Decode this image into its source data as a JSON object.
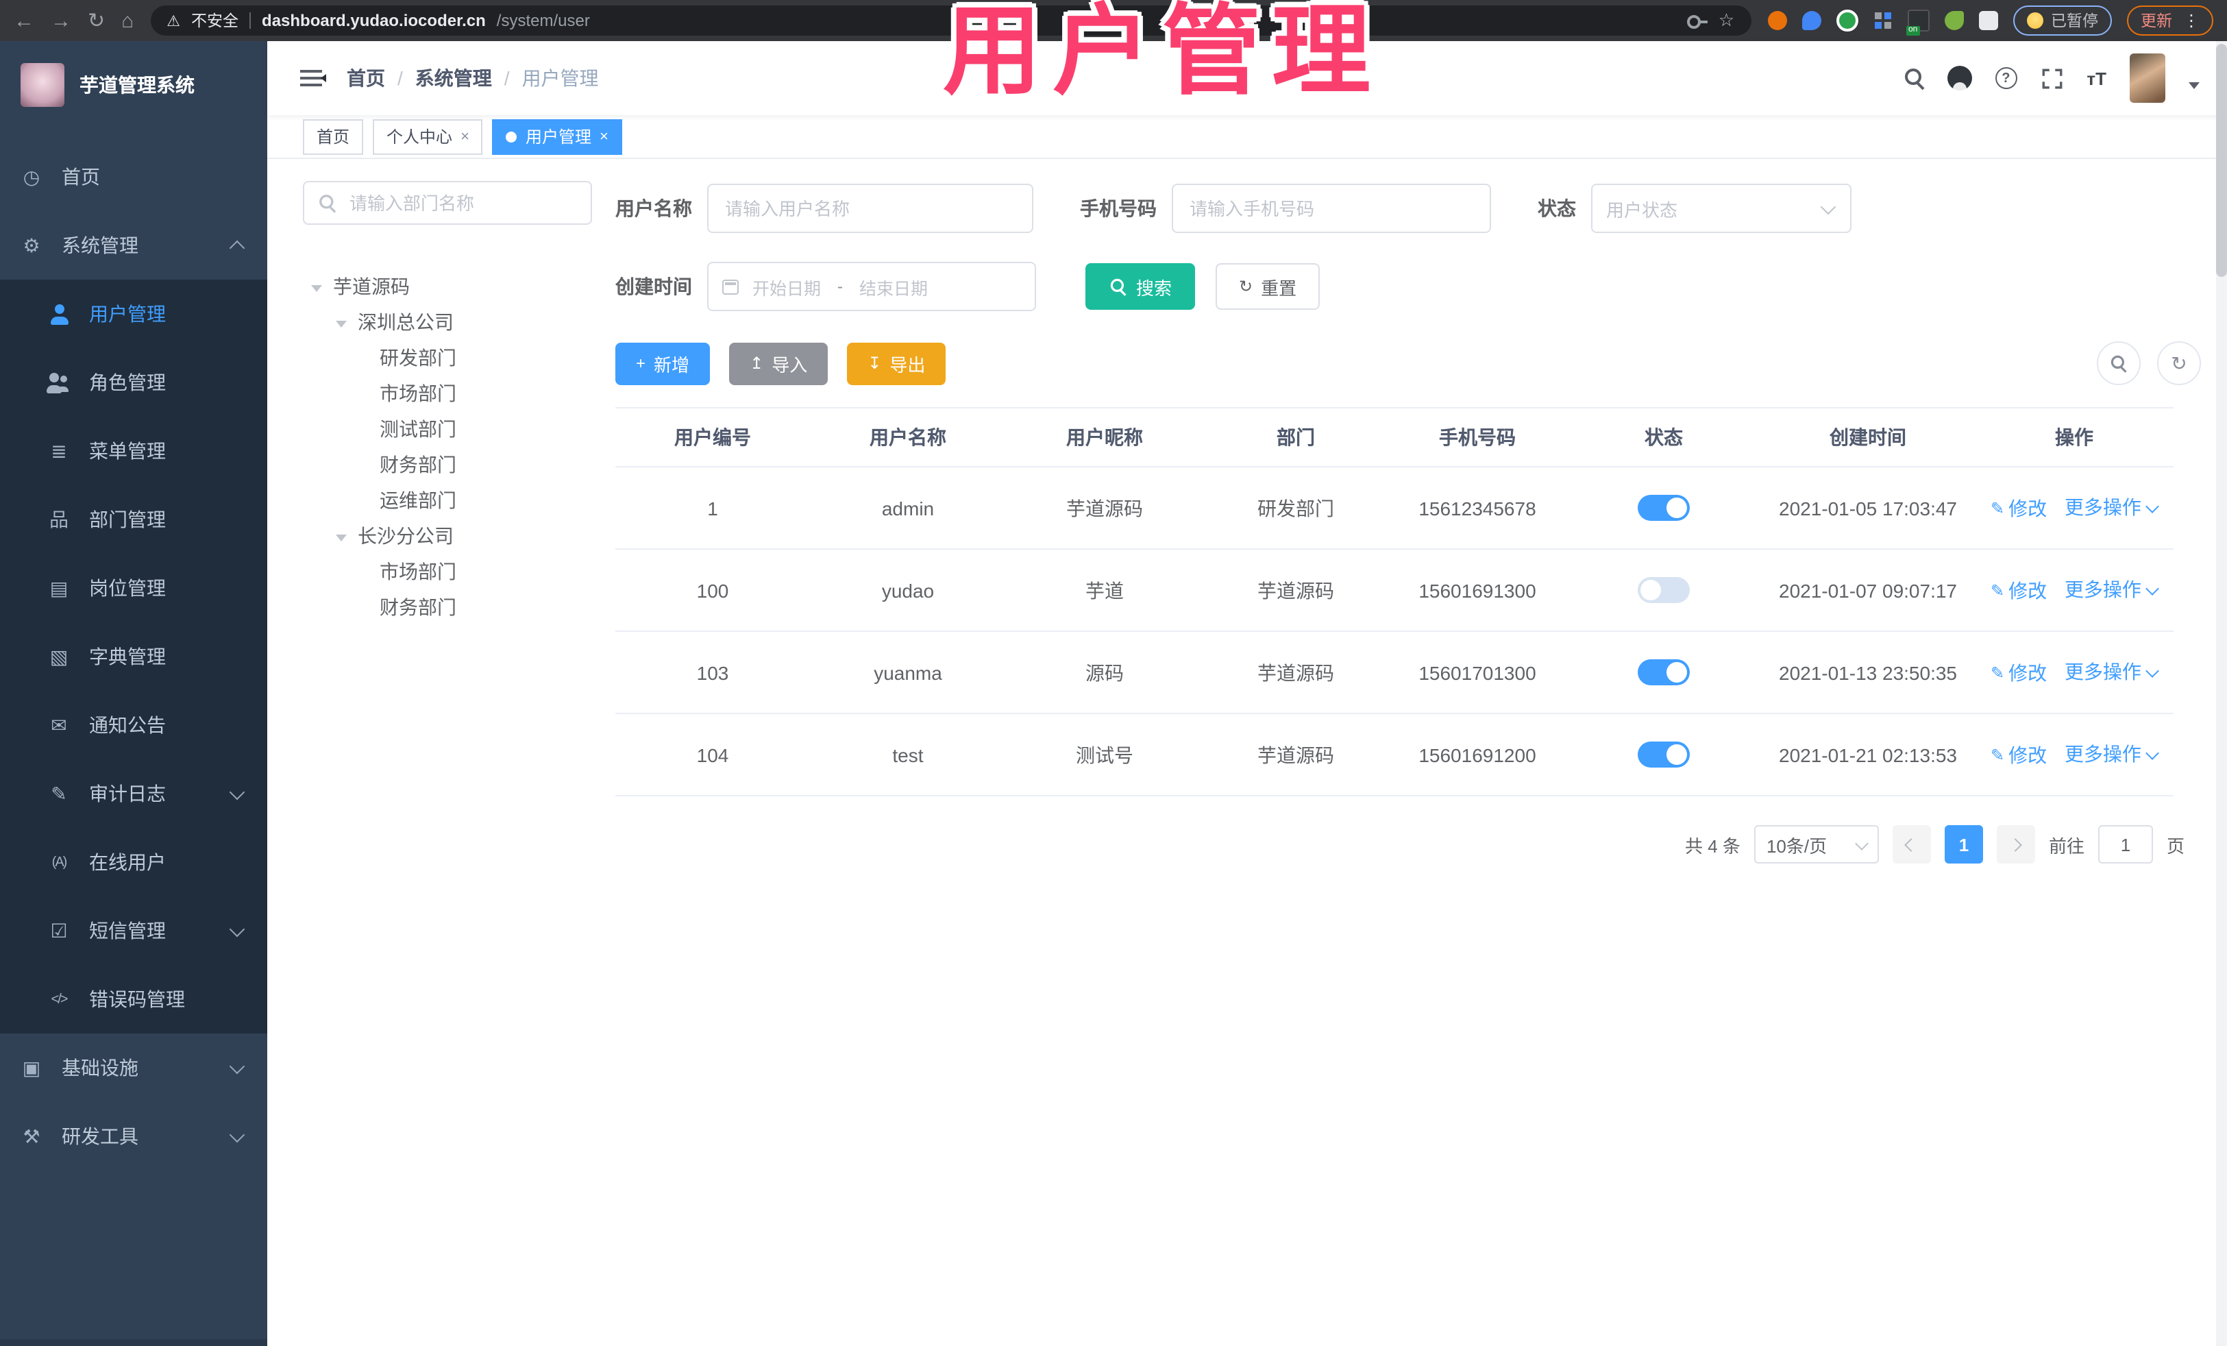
{
  "browser": {
    "security_label": "不安全",
    "url_host": "dashboard.yudao.iocoder.cn",
    "url_path": "/system/user",
    "paused_label": "已暂停",
    "update_label": "更新",
    "ext_on_label": "on"
  },
  "overlay_title": "用户管理",
  "icons": {
    "back": "←",
    "forward": "→",
    "reload": "↻",
    "home": "⌂",
    "warning": "⚠",
    "star": "☆",
    "kebab": "⋮",
    "close": "×",
    "help": "?",
    "font_size": "тT",
    "menu_home": "◷",
    "menu_system": "⚙",
    "menu_menu": "≣",
    "menu_dept": "品",
    "menu_post": "▤",
    "menu_dict": "▧",
    "menu_notice": "✉",
    "menu_audit": "✎",
    "menu_online": "(A)",
    "menu_sms": "☑",
    "menu_error": "</>",
    "menu_infra": "▣",
    "menu_tools": "⚒",
    "refresh": "↻",
    "plus": "+",
    "upload": "↥",
    "download": "↧",
    "edit": "✎"
  },
  "sidebar": {
    "app_title": "芋道管理系统",
    "home": "首页",
    "system": {
      "label": "系统管理",
      "children": [
        "用户管理",
        "角色管理",
        "菜单管理",
        "部门管理",
        "岗位管理",
        "字典管理",
        "通知公告",
        "审计日志",
        "在线用户",
        "短信管理",
        "错误码管理"
      ]
    },
    "infra": "基础设施",
    "devtools": "研发工具"
  },
  "header": {
    "breadcrumb": [
      "首页",
      "系统管理",
      "用户管理"
    ],
    "breadcrumb_separator": "/"
  },
  "tabs": [
    "首页",
    "个人中心",
    "用户管理"
  ],
  "tree": {
    "search_placeholder": "请输入部门名称",
    "root": "芋道源码",
    "shenzhen": {
      "label": "深圳总公司",
      "children": [
        "研发部门",
        "市场部门",
        "测试部门",
        "财务部门",
        "运维部门"
      ]
    },
    "changsha": {
      "label": "长沙分公司",
      "children": [
        "市场部门",
        "财务部门"
      ]
    }
  },
  "form": {
    "username_label": "用户名称",
    "username_placeholder": "请输入用户名称",
    "mobile_label": "手机号码",
    "mobile_placeholder": "请输入手机号码",
    "status_label": "状态",
    "status_placeholder": "用户状态",
    "createtime_label": "创建时间",
    "date_start_placeholder": "开始日期",
    "date_separator": "-",
    "date_end_placeholder": "结束日期",
    "search_label": "搜索",
    "reset_label": "重置"
  },
  "toolbar": {
    "add_label": "新增",
    "import_label": "导入",
    "export_label": "导出"
  },
  "table": {
    "columns": [
      "用户编号",
      "用户名称",
      "用户昵称",
      "部门",
      "手机号码",
      "状态",
      "创建时间",
      "操作"
    ],
    "edit_label": "修改",
    "more_label": "更多操作",
    "rows": [
      {
        "id": "1",
        "username": "admin",
        "nickname": "芋道源码",
        "dept": "研发部门",
        "mobile": "15612345678",
        "status": "on",
        "created": "2021-01-05 17:03:47"
      },
      {
        "id": "100",
        "username": "yudao",
        "nickname": "芋道",
        "dept": "芋道源码",
        "mobile": "15601691300",
        "status": "off",
        "created": "2021-01-07 09:07:17"
      },
      {
        "id": "103",
        "username": "yuanma",
        "nickname": "源码",
        "dept": "芋道源码",
        "mobile": "15601701300",
        "status": "on",
        "created": "2021-01-13 23:50:35"
      },
      {
        "id": "104",
        "username": "test",
        "nickname": "测试号",
        "dept": "芋道源码",
        "mobile": "15601691200",
        "status": "on",
        "created": "2021-01-21 02:13:53"
      }
    ]
  },
  "pagination": {
    "total": "共 4 条",
    "page_size": "10条/页",
    "current_page": "1",
    "goto_label": "前往",
    "goto_value": "1",
    "page_unit": "页"
  },
  "colors": {
    "accent": "#409EFF",
    "search_teal": "#1ABC9C",
    "export_amber": "#F0A71C",
    "overlay_pink": "#FA3F6E",
    "sidebar_bg": "#304156",
    "submenu_bg": "#1F2D3D"
  }
}
